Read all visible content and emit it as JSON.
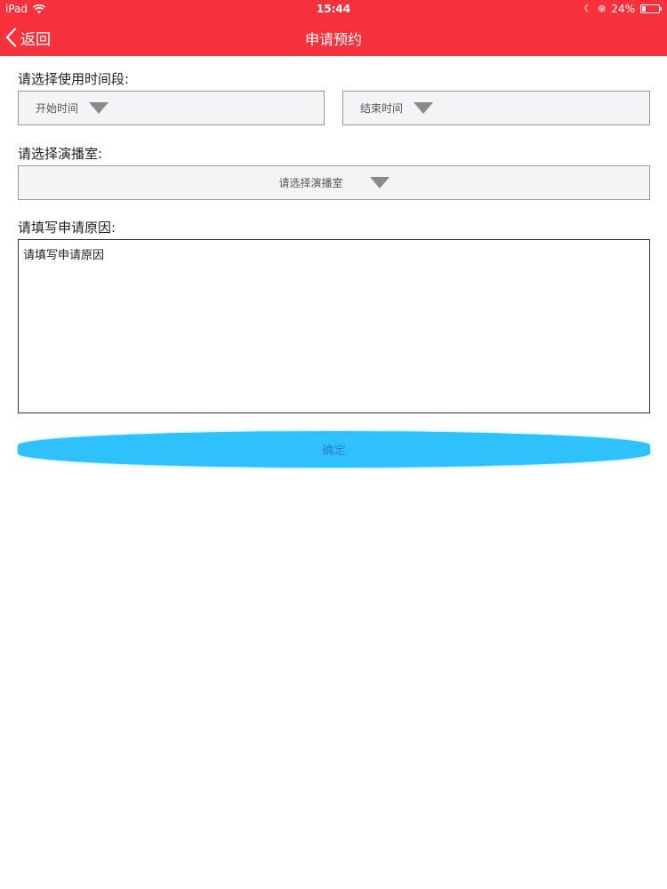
{
  "status_bar": {
    "device": "iPad",
    "time": "15:44",
    "battery": "24%",
    "battery_level": 0.24
  },
  "nav": {
    "back_label": "返回",
    "title": "申请预约"
  },
  "form": {
    "time_section_label": "请选择使用时间段:",
    "start_time_placeholder": "开始时间",
    "end_time_placeholder": "结束时间",
    "studio_section_label": "请选择演播室:",
    "studio_placeholder": "请选择演播室",
    "reason_section_label": "请填写申请原因:",
    "reason_placeholder": "请填写申请原因",
    "submit_label": "确定"
  },
  "icons": {
    "back": "chevron-left-icon",
    "dropdown": "triangle-down-icon",
    "wifi": "wifi-icon",
    "battery": "battery-icon"
  },
  "colors": {
    "header_background": "#f8323d",
    "submit_background": "#2ec1fb",
    "submit_text": "#2b7fd0",
    "picker_background": "#f4f4f6"
  }
}
